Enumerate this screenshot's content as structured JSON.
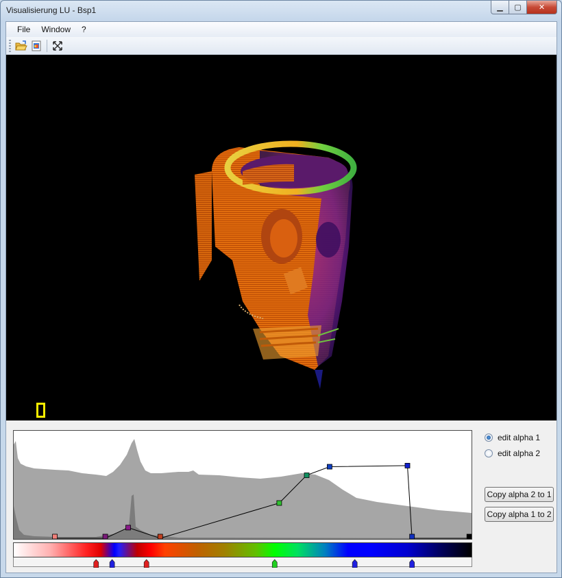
{
  "window": {
    "title": "Visualisierung LU - Bsp1",
    "caption": {
      "minimize": "▁",
      "maximize": "▢",
      "close": "✕"
    }
  },
  "menu": {
    "items": [
      "File",
      "Window",
      "?"
    ]
  },
  "toolbar": {
    "buttons": [
      {
        "icon": "open-folder-icon"
      },
      {
        "icon": "save-image-icon"
      },
      {
        "icon": "fullscreen-icon"
      }
    ]
  },
  "transfer_function": {
    "alpha_points": [
      {
        "value": 0.09,
        "alpha": 0.0,
        "color": "#f0807a"
      },
      {
        "value": 0.2,
        "alpha": 0.0,
        "color": "#7a1a7a"
      },
      {
        "value": 0.25,
        "alpha": 0.1,
        "color": "#8a1a8a"
      },
      {
        "value": 0.32,
        "alpha": 0.0,
        "color": "#c04020"
      },
      {
        "value": 0.58,
        "alpha": 0.33,
        "color": "#30c030"
      },
      {
        "value": 0.64,
        "alpha": 0.59,
        "color": "#109060"
      },
      {
        "value": 0.69,
        "alpha": 0.67,
        "color": "#1040c0"
      },
      {
        "value": 0.86,
        "alpha": 0.68,
        "color": "#1020d0"
      },
      {
        "value": 0.87,
        "alpha": 0.0,
        "color": "#1030c0"
      },
      {
        "value": 0.995,
        "alpha": 0.0,
        "color": "#000000"
      }
    ],
    "color_markers": [
      {
        "value": 0.18,
        "color": "#e02020"
      },
      {
        "value": 0.215,
        "color": "#2020e0"
      },
      {
        "value": 0.29,
        "color": "#e02020"
      },
      {
        "value": 0.57,
        "color": "#20d020"
      },
      {
        "value": 0.745,
        "color": "#2020e0"
      },
      {
        "value": 0.87,
        "color": "#2020e0"
      }
    ]
  },
  "controls": {
    "edit_alpha_1": "edit alpha 1",
    "edit_alpha_2": "edit alpha 2",
    "selected": "edit alpha 1",
    "copy_2_to_1": "Copy alpha 2 to 1",
    "copy_1_to_2": "Copy alpha 1 to 2"
  }
}
